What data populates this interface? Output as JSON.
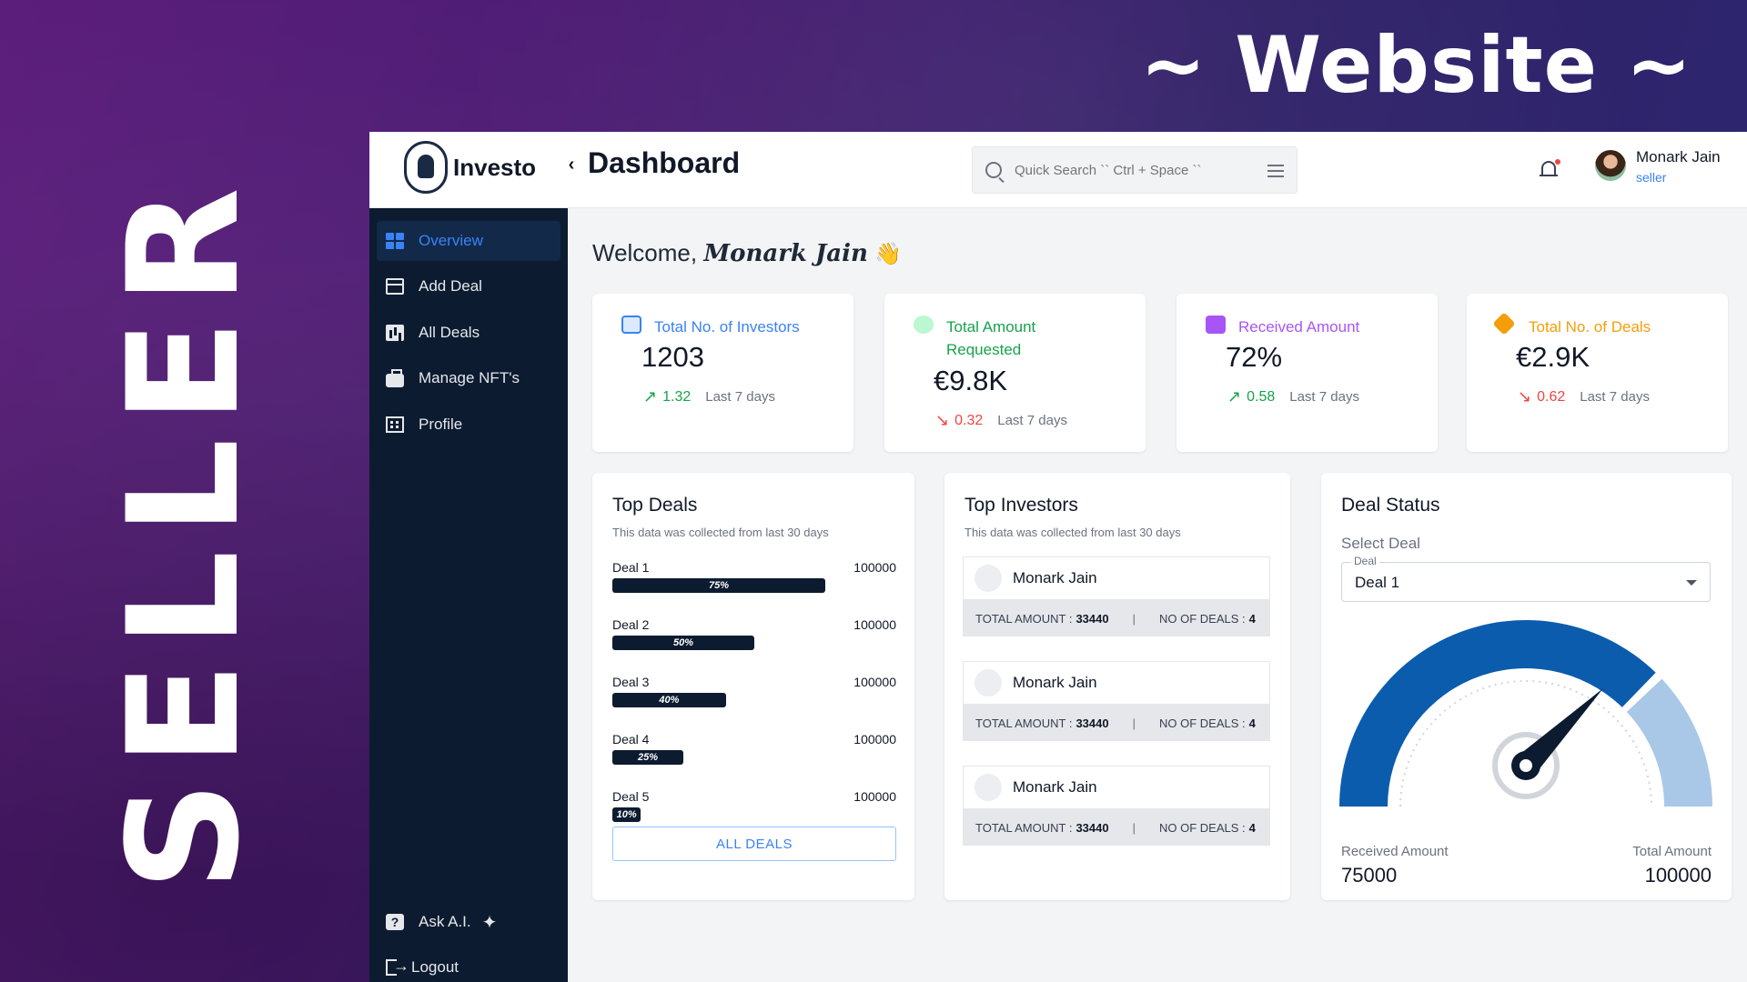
{
  "promo": {
    "title": "~ Website ~",
    "side_label": "SELLER"
  },
  "app": {
    "brand": "Investo",
    "collapse_glyph": "‹",
    "page_title": "Dashboard",
    "search": {
      "placeholder": "Quick Search `` Ctrl + Space ``"
    },
    "user": {
      "name": "Monark Jain",
      "role": "seller"
    }
  },
  "sidebar": {
    "items": [
      {
        "label": "Overview",
        "icon": "grid-icon",
        "active": true
      },
      {
        "label": "Add Deal",
        "icon": "card-add-icon"
      },
      {
        "label": "All Deals",
        "icon": "bar-chart-icon"
      },
      {
        "label": "Manage NFT's",
        "icon": "briefcase-icon"
      },
      {
        "label": "Profile",
        "icon": "building-icon"
      }
    ],
    "bottom": [
      {
        "label": "Ask A.I.",
        "icon": "help-icon",
        "extra_icon": "sparkle-icon",
        "extra_glyph": "✦"
      },
      {
        "label": "Logout",
        "icon": "logout-icon"
      }
    ]
  },
  "welcome": {
    "prefix": "Welcome,",
    "name": "Monark Jain",
    "emoji": "👋"
  },
  "stats": [
    {
      "label": "Total No. of Investors",
      "value": "1203",
      "trend": "1.32",
      "direction": "up",
      "period": "Last 7 days",
      "color": "#3b82f6",
      "icon": "briefcase-icon"
    },
    {
      "label": "Total Amount Requested",
      "value": "€9.8K",
      "trend": "0.32",
      "direction": "down",
      "period": "Last 7 days",
      "color": "#16a34a",
      "icon": "users-icon"
    },
    {
      "label": "Received Amount",
      "value": "72%",
      "trend": "0.58",
      "direction": "up",
      "period": "Last 7 days",
      "color": "#a855f7",
      "icon": "money-icon"
    },
    {
      "label": "Total No. of Deals",
      "value": "€2.9K",
      "trend": "0.62",
      "direction": "down",
      "period": "Last 7 days",
      "color": "#f59e0b",
      "icon": "tag-icon"
    }
  ],
  "top_deals": {
    "title": "Top Deals",
    "subtitle": "This data was collected from last 30 days",
    "deals": [
      {
        "name": "Deal 1",
        "amount": "100000",
        "percent": 75,
        "percent_label": "75%"
      },
      {
        "name": "Deal 2",
        "amount": "100000",
        "percent": 50,
        "percent_label": "50%"
      },
      {
        "name": "Deal 3",
        "amount": "100000",
        "percent": 40,
        "percent_label": "40%"
      },
      {
        "name": "Deal 4",
        "amount": "100000",
        "percent": 25,
        "percent_label": "25%"
      },
      {
        "name": "Deal 5",
        "amount": "100000",
        "percent": 10,
        "percent_label": "10%"
      }
    ],
    "button": "ALL DEALS"
  },
  "top_investors": {
    "title": "Top Investors",
    "subtitle": "This data was collected from last 30 days",
    "investors": [
      {
        "name": "Monark Jain",
        "total_label": "TOTAL AMOUNT :",
        "total": "33440",
        "deals_label": "NO OF DEALS :",
        "deals": "4"
      },
      {
        "name": "Monark Jain",
        "total_label": "TOTAL AMOUNT :",
        "total": "33440",
        "deals_label": "NO OF DEALS :",
        "deals": "4"
      },
      {
        "name": "Monark Jain",
        "total_label": "TOTAL AMOUNT :",
        "total": "33440",
        "deals_label": "NO OF DEALS :",
        "deals": "4"
      }
    ]
  },
  "deal_status": {
    "title": "Deal Status",
    "select_label": "Select Deal",
    "select_legend": "Deal",
    "selected": "Deal 1",
    "received_label": "Received Amount",
    "received": "75000",
    "total_label": "Total Amount",
    "total": "100000",
    "received_value": 75000,
    "total_value": 100000,
    "colors": {
      "filled": "#0b5cad",
      "remaining": "#a9c8e8"
    }
  }
}
